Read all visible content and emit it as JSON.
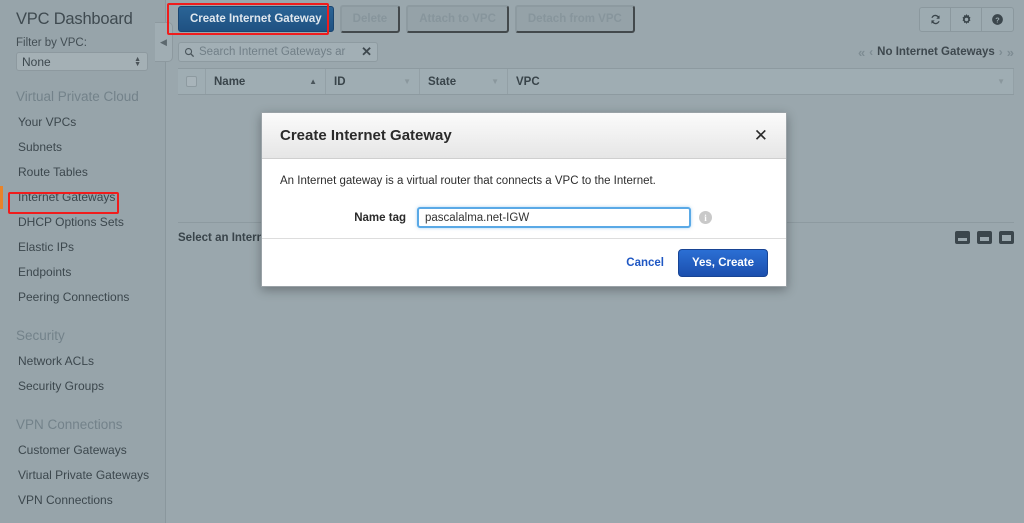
{
  "sidebar": {
    "title": "VPC Dashboard",
    "filter_label": "Filter by VPC:",
    "filter_value": "None",
    "groups": [
      {
        "label": "Virtual Private Cloud",
        "items": [
          {
            "label": "Your VPCs",
            "active": false
          },
          {
            "label": "Subnets",
            "active": false
          },
          {
            "label": "Route Tables",
            "active": false
          },
          {
            "label": "Internet Gateways",
            "active": true
          },
          {
            "label": "DHCP Options Sets",
            "active": false
          },
          {
            "label": "Elastic IPs",
            "active": false
          },
          {
            "label": "Endpoints",
            "active": false
          },
          {
            "label": "Peering Connections",
            "active": false
          }
        ]
      },
      {
        "label": "Security",
        "items": [
          {
            "label": "Network ACLs",
            "active": false
          },
          {
            "label": "Security Groups",
            "active": false
          }
        ]
      },
      {
        "label": "VPN Connections",
        "items": [
          {
            "label": "Customer Gateways",
            "active": false
          },
          {
            "label": "Virtual Private Gateways",
            "active": false
          },
          {
            "label": "VPN Connections",
            "active": false
          }
        ]
      }
    ]
  },
  "toolbar": {
    "create_label": "Create Internet Gateway",
    "delete_label": "Delete",
    "attach_label": "Attach to VPC",
    "detach_label": "Detach from VPC",
    "refresh_icon": "refresh-icon",
    "settings_icon": "gear-icon",
    "help_icon": "help-icon"
  },
  "search": {
    "placeholder": "Search Internet Gateways ar",
    "search_icon": "search-icon",
    "clear_icon": "close-icon"
  },
  "pager": {
    "status": "No Internet Gateways",
    "first": "«",
    "prev": "‹",
    "next": "›",
    "last": "»"
  },
  "table": {
    "columns": [
      {
        "label": "Name",
        "sort": "▲",
        "sorted": true
      },
      {
        "label": "ID",
        "sort": "▼",
        "sorted": false
      },
      {
        "label": "State",
        "sort": "▼",
        "sorted": false
      },
      {
        "label": "VPC",
        "sort": "▼",
        "sorted": false
      }
    ],
    "rows": []
  },
  "detail": {
    "text": "Select an Intern",
    "panel_icons": [
      "panel-bottom-small-icon",
      "panel-bottom-medium-icon",
      "panel-bottom-large-icon"
    ]
  },
  "modal": {
    "title": "Create Internet Gateway",
    "close_label": "✕",
    "description": "An Internet gateway is a virtual router that connects a VPC to the Internet.",
    "name_tag_label": "Name tag",
    "name_tag_value": "pascalalma.net-IGW",
    "info_label": "i",
    "cancel_label": "Cancel",
    "confirm_label": "Yes, Create"
  },
  "colors": {
    "primary_blue": "#2b6fd4",
    "toolbar_blue": "#2a6496",
    "annotation_red": "#f01c1c",
    "active_orange": "#e8832a",
    "overlay_gray": "#9aa7ad"
  }
}
